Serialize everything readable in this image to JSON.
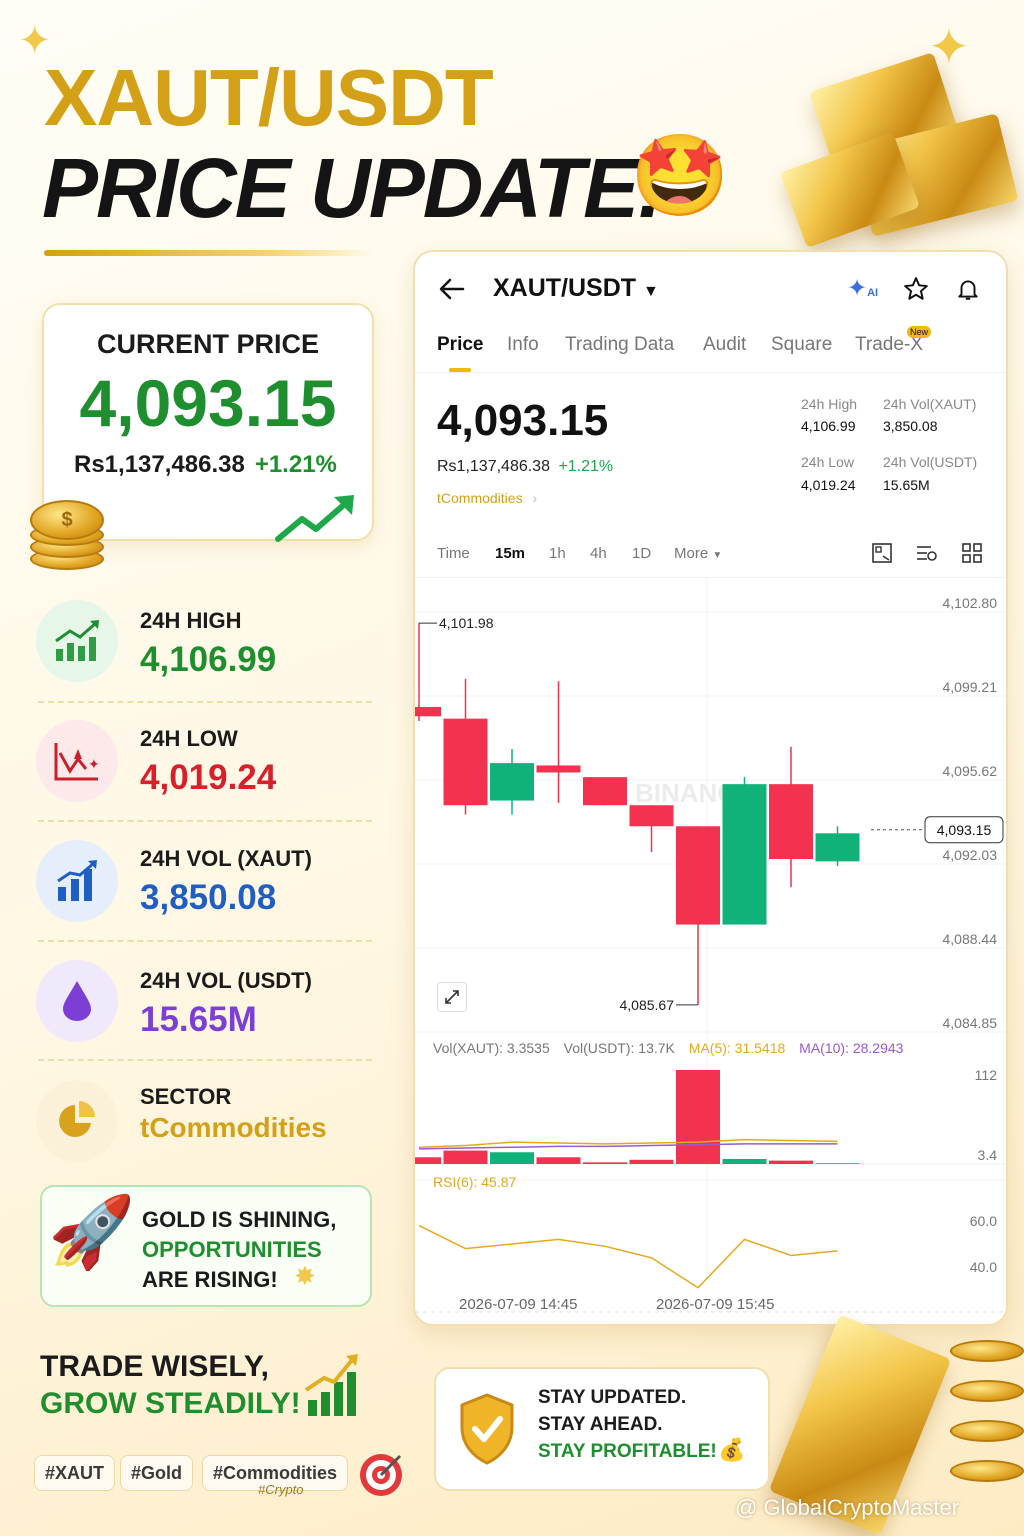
{
  "headline": {
    "line1": "XAUT/USDT",
    "line2": "PRICE UPDATE!",
    "emoji": "🤩"
  },
  "current_price_card": {
    "label": "CURRENT PRICE",
    "price": "4,093.15",
    "local_price": "Rs1,137,486.38",
    "change": "+1.21%"
  },
  "stats": [
    {
      "label": "24H HIGH",
      "value": "4,106.99",
      "color": "#1e8e2e",
      "icon": "chart-up-icon"
    },
    {
      "label": "24H LOW",
      "value": "4,019.24",
      "color": "#d81f2a",
      "icon": "chart-down-icon"
    },
    {
      "label": "24H VOL (XAUT)",
      "value": "3,850.08",
      "color": "#1f5fc4",
      "icon": "bar-chart-icon"
    },
    {
      "label": "24H VOL (USDT)",
      "value": "15.65M",
      "color": "#7c3fd6",
      "icon": "drop-icon"
    },
    {
      "label": "SECTOR",
      "value": "tCommodities",
      "color": "#d4a017",
      "icon": "pie-chart-icon"
    }
  ],
  "shine_card": {
    "line1": "GOLD IS SHINING,",
    "line2": "OPPORTUNITIES",
    "line3": "ARE RISING!"
  },
  "trade_wisely": {
    "line1": "TRADE WISELY,",
    "line2": "GROW STEADILY!"
  },
  "tags": [
    "#XAUT",
    "#Gold",
    "#Commodities"
  ],
  "tag_sub": "#Crypto",
  "phone": {
    "pair": "XAUT/USDT",
    "ai_label": "AI",
    "tabs": [
      "Price",
      "Info",
      "Trading Data",
      "Audit",
      "Square",
      "Trade-X"
    ],
    "new_badge": "New",
    "price": "4,093.15",
    "local_price": "Rs1,137,486.38",
    "change": "+1.21%",
    "sector_link": "tCommodities",
    "stats": {
      "high_label": "24h High",
      "high_value": "4,106.99",
      "vol_xaut_label": "24h Vol(XAUT)",
      "vol_xaut_value": "3,850.08",
      "low_label": "24h Low",
      "low_value": "4,019.24",
      "vol_usdt_label": "24h Vol(USDT)",
      "vol_usdt_value": "15.65M"
    },
    "intervals": [
      "Time",
      "15m",
      "1h",
      "4h",
      "1D",
      "More"
    ],
    "active_interval": "15m",
    "watermark": "BINANCE",
    "volume_legend": {
      "vol_xaut": "Vol(XAUT): 3.3535",
      "vol_usdt": "Vol(USDT): 13.7K",
      "ma5": "MA(5): 31.5418",
      "ma10": "MA(10): 28.2943"
    },
    "rsi_legend": "RSI(6): 45.87",
    "time_labels": [
      "2026-07-09 14:45",
      "2026-07-09 15:45"
    ]
  },
  "chart_data": {
    "type": "candlestick",
    "price_axis_ticks": [
      "4,102.80",
      "4,099.21",
      "4,095.62",
      "4,092.03",
      "4,088.44",
      "4,084.85"
    ],
    "price_range": [
      4084.85,
      4102.8
    ],
    "high_annotation": "4,101.98",
    "low_annotation": "4,085.67",
    "last_price_label": "4,093.15",
    "candles": [
      {
        "open": 4098.4,
        "close": 4098.0,
        "high": 4101.98,
        "low": 4097.8
      },
      {
        "open": 4097.9,
        "close": 4094.2,
        "high": 4099.6,
        "low": 4093.8
      },
      {
        "open": 4094.4,
        "close": 4096.0,
        "high": 4096.6,
        "low": 4093.8
      },
      {
        "open": 4095.9,
        "close": 4095.6,
        "high": 4099.5,
        "low": 4094.3
      },
      {
        "open": 4095.4,
        "close": 4094.2,
        "high": 4095.4,
        "low": 4094.2
      },
      {
        "open": 4094.2,
        "close": 4093.3,
        "high": 4094.2,
        "low": 4092.2
      },
      {
        "open": 4093.3,
        "close": 4089.1,
        "high": 4093.3,
        "low": 4085.67
      },
      {
        "open": 4089.1,
        "close": 4095.1,
        "high": 4095.4,
        "low": 4089.1
      },
      {
        "open": 4095.1,
        "close": 4091.9,
        "high": 4096.7,
        "low": 4090.7
      },
      {
        "open": 4091.8,
        "close": 4093.0,
        "high": 4093.3,
        "low": 4091.6
      }
    ],
    "volume_axis_ticks": [
      "112",
      "3.4"
    ],
    "volumes": [
      8,
      16,
      14,
      8,
      2,
      5,
      112,
      6,
      4,
      1
    ],
    "ma5": [
      20,
      22,
      26,
      25,
      24,
      25,
      26,
      29,
      28,
      27
    ],
    "ma10": [
      18,
      19,
      20,
      21,
      21,
      22,
      23,
      24,
      24,
      24
    ],
    "rsi_axis_ticks": [
      "60.0",
      "40.0"
    ],
    "rsi_range": [
      30,
      70
    ],
    "rsi": [
      58,
      48,
      50,
      52,
      49,
      44,
      31,
      52,
      45,
      47
    ]
  },
  "stay_card": {
    "line1": "STAY UPDATED.",
    "line2": "STAY AHEAD.",
    "line3": "STAY PROFITABLE!"
  },
  "credit": "@ GlobalCryptoMaster",
  "colors": {
    "gold": "#d4a017",
    "green": "#1e8e2e",
    "red": "#d81f2a",
    "up_candle": "#10b27a",
    "down_candle": "#f2324e"
  }
}
